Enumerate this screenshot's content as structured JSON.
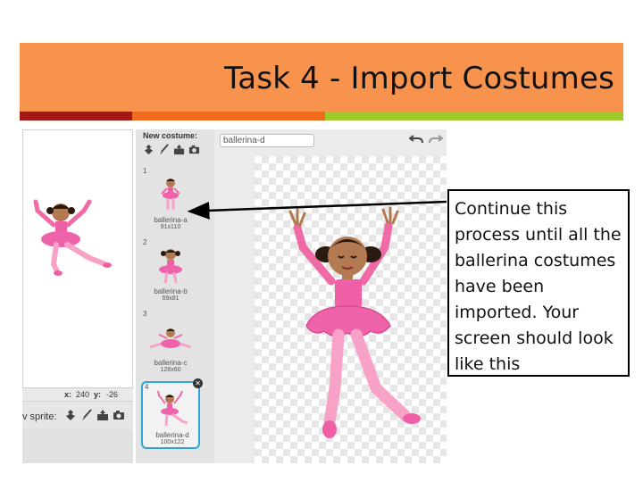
{
  "slide": {
    "title": "Task 4 - Import Costumes",
    "callout": "Continue this process until all the ballerina costumes have been imported. Your screen should look like this"
  },
  "colors": {
    "title_bar": "#f7934c",
    "stripe_red": "#a31717",
    "stripe_orange": "#f26b1d",
    "stripe_green": "#9cc92b",
    "selection": "#2ea4d8"
  },
  "stage": {
    "x_label": "x:",
    "x_value": "240",
    "y_label": "y:",
    "y_value": "-26",
    "new_sprite_label": "v sprite:"
  },
  "costume_panel": {
    "new_costume_label": "New costume:",
    "costumes": [
      {
        "number": "1",
        "name": "ballerina-a",
        "size": "91x110"
      },
      {
        "number": "2",
        "name": "ballerina-b",
        "size": "69x81"
      },
      {
        "number": "3",
        "name": "ballerina-c",
        "size": "128x60"
      },
      {
        "number": "4",
        "name": "ballerina-d",
        "size": "100x122",
        "selected": true
      }
    ]
  },
  "editor": {
    "costume_name": "ballerina-d"
  },
  "icons": [
    "stamp-icon",
    "paintbrush-icon",
    "upload-icon",
    "camera-icon",
    "undo-icon",
    "redo-icon",
    "close-icon"
  ]
}
